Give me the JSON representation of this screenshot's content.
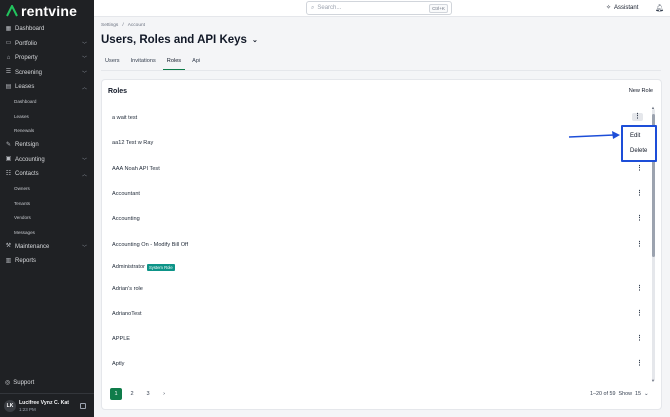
{
  "app": {
    "logo_text": "rentvine"
  },
  "sidebar": {
    "items": [
      {
        "label": "Dashboard",
        "icon": "dashboard-icon"
      },
      {
        "label": "Portfolio",
        "icon": "portfolio-icon",
        "chevron": "down"
      },
      {
        "label": "Property",
        "icon": "property-icon",
        "chevron": "down"
      },
      {
        "label": "Screening",
        "icon": "screening-icon",
        "chevron": "down"
      },
      {
        "label": "Leases",
        "icon": "leases-icon",
        "chevron": "up"
      },
      {
        "label": "Dashboard",
        "sub": true
      },
      {
        "label": "Leases",
        "sub": true
      },
      {
        "label": "Renewals",
        "sub": true
      },
      {
        "label": "Rentsign",
        "icon": "rentsign-icon"
      },
      {
        "label": "Accounting",
        "icon": "accounting-icon",
        "chevron": "down"
      },
      {
        "label": "Contacts",
        "icon": "contacts-icon",
        "chevron": "up"
      },
      {
        "label": "Owners",
        "sub": true
      },
      {
        "label": "Tenants",
        "sub": true
      },
      {
        "label": "Vendors",
        "sub": true
      },
      {
        "label": "Messages",
        "sub": true
      },
      {
        "label": "Maintenance",
        "icon": "maintenance-icon",
        "chevron": "down"
      },
      {
        "label": "Reports",
        "icon": "reports-icon"
      }
    ],
    "support_label": "Support",
    "user": {
      "initials": "LK",
      "name": "Lucifree Vynz C. Kat",
      "time": "1:23 PM"
    }
  },
  "topbar": {
    "search_placeholder": "Search...",
    "search_shortcut": "Ctrl+K",
    "assistant_label": "Assistant"
  },
  "header": {
    "breadcrumbs": [
      "Settings",
      "/",
      "Account"
    ],
    "title": "Users, Roles and API Keys",
    "tabs": [
      "Users",
      "Invitations",
      "Roles",
      "Api"
    ],
    "active_tab": "Roles"
  },
  "roles": {
    "title": "Roles",
    "new_role_label": "New Role",
    "rows": [
      {
        "name": "a wait test"
      },
      {
        "name": "aa12 Test w Ray"
      },
      {
        "name": "AAA Noah API Test"
      },
      {
        "name": "Accountant"
      },
      {
        "name": "Accounting"
      },
      {
        "name": "Accounting On - Modify Bill Off"
      },
      {
        "name": "Administrator",
        "badge": "System Role"
      },
      {
        "name": "Adrian's role"
      },
      {
        "name": "AdrianoTest"
      },
      {
        "name": "APPLE"
      },
      {
        "name": "Aptly"
      }
    ],
    "menu": {
      "items": [
        "Edit",
        "Delete"
      ]
    }
  },
  "pagination": {
    "pages": [
      "1",
      "2",
      "3"
    ],
    "active_page": "1",
    "next_label": "›",
    "range_text": "1–20 of 59",
    "show_label": "Show",
    "show_value": "15"
  },
  "colors": {
    "sidebar_bg": "#1f2124",
    "accent_green": "#0f7c4a",
    "highlight_blue": "#1d4ed8",
    "badge_teal": "#0d9488"
  }
}
